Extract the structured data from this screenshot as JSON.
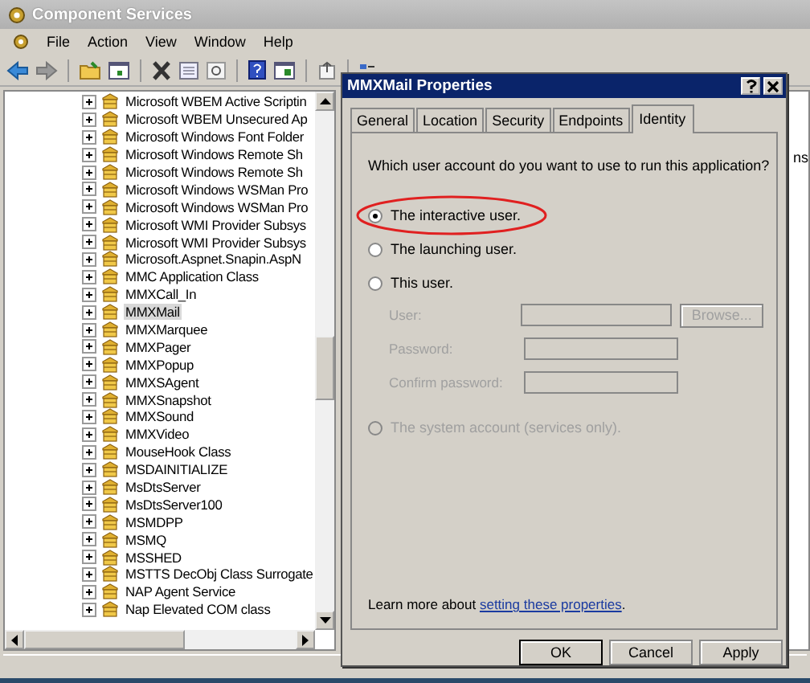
{
  "window": {
    "title": "Component Services"
  },
  "menu": [
    "File",
    "Action",
    "View",
    "Window",
    "Help"
  ],
  "tree": {
    "items": [
      {
        "label": "Microsoft WBEM Active Scriptin",
        "selected": false,
        "expanded": false
      },
      {
        "label": "Microsoft WBEM Unsecured Ap",
        "selected": false,
        "expanded": false
      },
      {
        "label": "Microsoft Windows Font Folder",
        "selected": false,
        "expanded": false
      },
      {
        "label": "Microsoft Windows Remote Sh",
        "selected": false,
        "expanded": false
      },
      {
        "label": "Microsoft Windows Remote Sh",
        "selected": false,
        "expanded": false
      },
      {
        "label": "Microsoft Windows WSMan Pro",
        "selected": false,
        "expanded": false
      },
      {
        "label": "Microsoft Windows WSMan Pro",
        "selected": false,
        "expanded": false
      },
      {
        "label": "Microsoft WMI Provider Subsys",
        "selected": false,
        "expanded": false
      },
      {
        "label": "Microsoft WMI Provider Subsys",
        "selected": false,
        "expanded": false
      },
      {
        "label": "Microsoft.Aspnet.Snapin.AspN",
        "selected": false,
        "expanded": false
      },
      {
        "label": "MMC Application Class",
        "selected": false,
        "expanded": false
      },
      {
        "label": "MMXCall_In",
        "selected": false,
        "expanded": false
      },
      {
        "label": "MMXMail",
        "selected": true,
        "expanded": false
      },
      {
        "label": "MMXMarquee",
        "selected": false,
        "expanded": false
      },
      {
        "label": "MMXPager",
        "selected": false,
        "expanded": false
      },
      {
        "label": "MMXPopup",
        "selected": false,
        "expanded": false
      },
      {
        "label": "MMXSAgent",
        "selected": false,
        "expanded": false
      },
      {
        "label": "MMXSnapshot",
        "selected": false,
        "expanded": false
      },
      {
        "label": "MMXSound",
        "selected": false,
        "expanded": false
      },
      {
        "label": "MMXVideo",
        "selected": false,
        "expanded": false
      },
      {
        "label": "MouseHook Class",
        "selected": false,
        "expanded": false
      },
      {
        "label": "MSDAINITIALIZE",
        "selected": false,
        "expanded": false
      },
      {
        "label": "MsDtsServer",
        "selected": false,
        "expanded": false
      },
      {
        "label": "MsDtsServer100",
        "selected": false,
        "expanded": false
      },
      {
        "label": "MSMDPP",
        "selected": false,
        "expanded": false
      },
      {
        "label": "MSMQ",
        "selected": false,
        "expanded": false
      },
      {
        "label": "MSSHED",
        "selected": false,
        "expanded": false
      },
      {
        "label": "MSTTS DecObj Class Surrogate",
        "selected": false,
        "expanded": false
      },
      {
        "label": "NAP Agent Service",
        "selected": false,
        "expanded": false
      },
      {
        "label": "Nap Elevated COM class",
        "selected": false,
        "expanded": false
      }
    ]
  },
  "right_pane": {
    "text": "ns"
  },
  "dialog": {
    "title": "MMXMail Properties",
    "tabs": [
      {
        "label": "General",
        "selected": false
      },
      {
        "label": "Location",
        "selected": false
      },
      {
        "label": "Security",
        "selected": false
      },
      {
        "label": "Endpoints",
        "selected": false
      },
      {
        "label": "Identity",
        "selected": true
      }
    ],
    "question": "Which user account do you want to use to run this application?",
    "options": [
      {
        "label": "The interactive user.",
        "selected": true,
        "disabled": false,
        "highlighted": true
      },
      {
        "label": "The launching user.",
        "selected": false,
        "disabled": false,
        "highlighted": false
      },
      {
        "label": "This user.",
        "selected": false,
        "disabled": false,
        "highlighted": false
      },
      {
        "label": "The system account (services only).",
        "selected": false,
        "disabled": true,
        "highlighted": false
      }
    ],
    "fields": [
      {
        "label": "User:",
        "disabled": true
      },
      {
        "label": "Password:",
        "disabled": true
      },
      {
        "label": "Confirm password:",
        "disabled": true
      }
    ],
    "browse_button": {
      "label": "Browse...",
      "disabled": true
    },
    "learn_more": {
      "prefix": "Learn more about ",
      "link": "setting these properties",
      "suffix": "."
    },
    "buttons": [
      {
        "label": "OK",
        "default": true
      },
      {
        "label": "Cancel",
        "default": false
      },
      {
        "label": "Apply",
        "default": false
      }
    ]
  }
}
